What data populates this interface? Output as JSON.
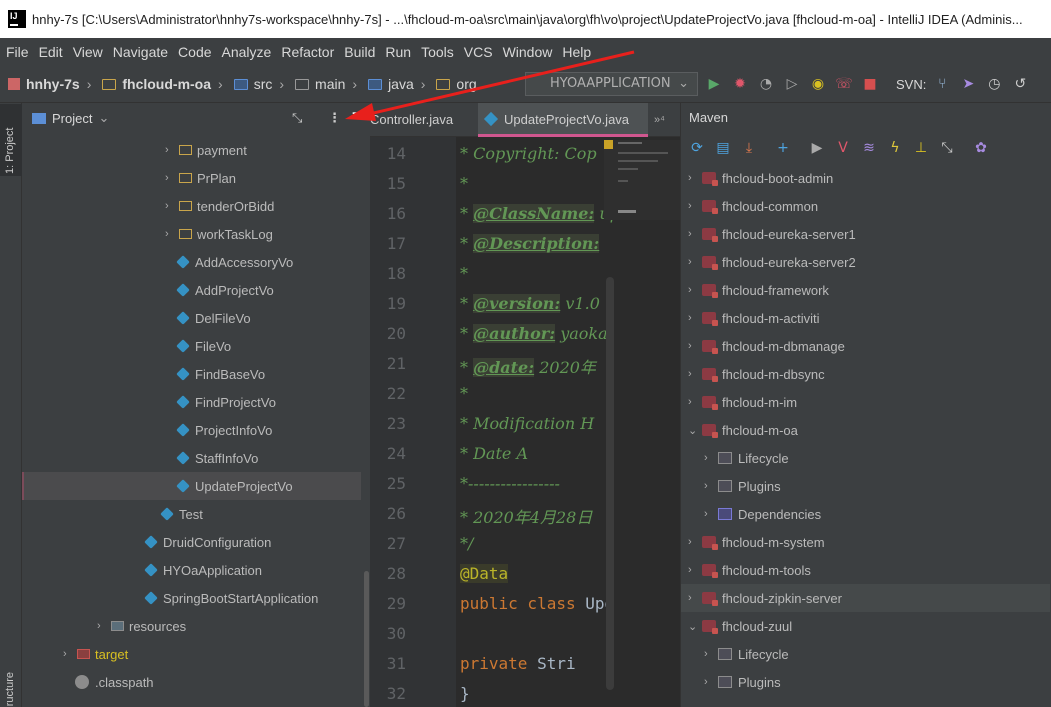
{
  "window": {
    "title": "hnhy-7s [C:\\Users\\Administrator\\hnhy7s-workspace\\hnhy-7s] - ...\\fhcloud-m-oa\\src\\main\\java\\org\\fh\\vo\\project\\UpdateProjectVo.java [fhcloud-m-oa] - IntelliJ IDEA (Adminis..."
  },
  "menu": [
    "File",
    "Edit",
    "View",
    "Navigate",
    "Code",
    "Analyze",
    "Refactor",
    "Build",
    "Run",
    "Tools",
    "VCS",
    "Window",
    "Help"
  ],
  "breadcrumbs": [
    "hnhy-7s",
    "fhcloud-m-oa",
    "src",
    "main",
    "java",
    "org"
  ],
  "run_config": "HYOAAPPLICATION",
  "svn_label": "SVN:",
  "project_panel": {
    "title": "Project",
    "stripe_label": "1: Project",
    "bottom_stripe_label": "ructure",
    "tree": [
      {
        "label": "payment",
        "type": "folder",
        "expandable": true
      },
      {
        "label": "PrPlan",
        "type": "folder",
        "expandable": true
      },
      {
        "label": "tenderOrBidd",
        "type": "folder",
        "expandable": true
      },
      {
        "label": "workTaskLog",
        "type": "folder",
        "expandable": true
      },
      {
        "label": "AddAccessoryVo",
        "type": "class"
      },
      {
        "label": "AddProjectVo",
        "type": "class"
      },
      {
        "label": "DelFileVo",
        "type": "class"
      },
      {
        "label": "FileVo",
        "type": "class"
      },
      {
        "label": "FindBaseVo",
        "type": "class"
      },
      {
        "label": "FindProjectVo",
        "type": "class"
      },
      {
        "label": "ProjectInfoVo",
        "type": "class"
      },
      {
        "label": "StaffInfoVo",
        "type": "class"
      },
      {
        "label": "UpdateProjectVo",
        "type": "class",
        "selected": true
      },
      {
        "label": "Test",
        "type": "class"
      },
      {
        "label": "DruidConfiguration",
        "type": "class"
      },
      {
        "label": "HYOaApplication",
        "type": "class"
      },
      {
        "label": "SpringBootStartApplication",
        "type": "class"
      },
      {
        "label": "resources",
        "type": "resources",
        "expandable": true
      },
      {
        "label": "target",
        "type": "target",
        "expandable": true
      },
      {
        "label": ".classpath",
        "type": "file"
      }
    ]
  },
  "editor": {
    "tabs": [
      {
        "label": "Controller.java",
        "active": false
      },
      {
        "label": "UpdateProjectVo.java",
        "active": true
      }
    ],
    "more_tabs": "⁴",
    "lines": [
      {
        "n": "14",
        "text": "* Copyright: Cop"
      },
      {
        "n": "15",
        "text": "*"
      },
      {
        "n": "16",
        "tag": "@ClassName:",
        "rest": " up"
      },
      {
        "n": "17",
        "tag": "@Description:",
        "rest": ""
      },
      {
        "n": "18",
        "text": "*"
      },
      {
        "n": "19",
        "tag": "@version:",
        "rest": " v1.0"
      },
      {
        "n": "20",
        "tag": "@author:",
        "rest": " yaoka"
      },
      {
        "n": "21",
        "tag": "@date:",
        "rest": " 2020年"
      },
      {
        "n": "22",
        "text": "*"
      },
      {
        "n": "23",
        "text": "* Modification H"
      },
      {
        "n": "24",
        "text": "* Date          A"
      },
      {
        "n": "25",
        "text": "*-----------------"
      },
      {
        "n": "26",
        "text": "* 2020年4月28日"
      },
      {
        "n": "27",
        "text": "*/"
      },
      {
        "n": "28",
        "annotation": "@Data"
      },
      {
        "n": "29",
        "kw": "public class ",
        "plain": "Upd"
      },
      {
        "n": "30",
        "text": ""
      },
      {
        "n": "31",
        "kw": "    private ",
        "plain": "Stri"
      },
      {
        "n": "32",
        "plain": "}"
      }
    ]
  },
  "maven": {
    "title": "Maven",
    "tree": [
      {
        "label": "fhcloud-boot-admin",
        "level": 0,
        "expanded": false
      },
      {
        "label": "fhcloud-common",
        "level": 0,
        "expanded": false
      },
      {
        "label": "fhcloud-eureka-server1",
        "level": 0,
        "expanded": false
      },
      {
        "label": "fhcloud-eureka-server2",
        "level": 0,
        "expanded": false
      },
      {
        "label": "fhcloud-framework",
        "level": 0,
        "expanded": false
      },
      {
        "label": "fhcloud-m-activiti",
        "level": 0,
        "expanded": false
      },
      {
        "label": "fhcloud-m-dbmanage",
        "level": 0,
        "expanded": false
      },
      {
        "label": "fhcloud-m-dbsync",
        "level": 0,
        "expanded": false
      },
      {
        "label": "fhcloud-m-im",
        "level": 0,
        "expanded": false
      },
      {
        "label": "fhcloud-m-oa",
        "level": 0,
        "expanded": true
      },
      {
        "label": "Lifecycle",
        "level": 1,
        "expanded": false
      },
      {
        "label": "Plugins",
        "level": 1,
        "expanded": false
      },
      {
        "label": "Dependencies",
        "level": 1,
        "expanded": false
      },
      {
        "label": "fhcloud-m-system",
        "level": 0,
        "expanded": false
      },
      {
        "label": "fhcloud-m-tools",
        "level": 0,
        "expanded": false
      },
      {
        "label": "fhcloud-zipkin-server",
        "level": 0,
        "expanded": false,
        "highlight": true
      },
      {
        "label": "fhcloud-zuul",
        "level": 0,
        "expanded": true
      },
      {
        "label": "Lifecycle",
        "level": 1,
        "expanded": false
      },
      {
        "label": "Plugins",
        "level": 1,
        "expanded": false
      }
    ]
  },
  "colors": {
    "accent_tab": "#d0578f",
    "annotation_arrow": "#e8201c"
  }
}
